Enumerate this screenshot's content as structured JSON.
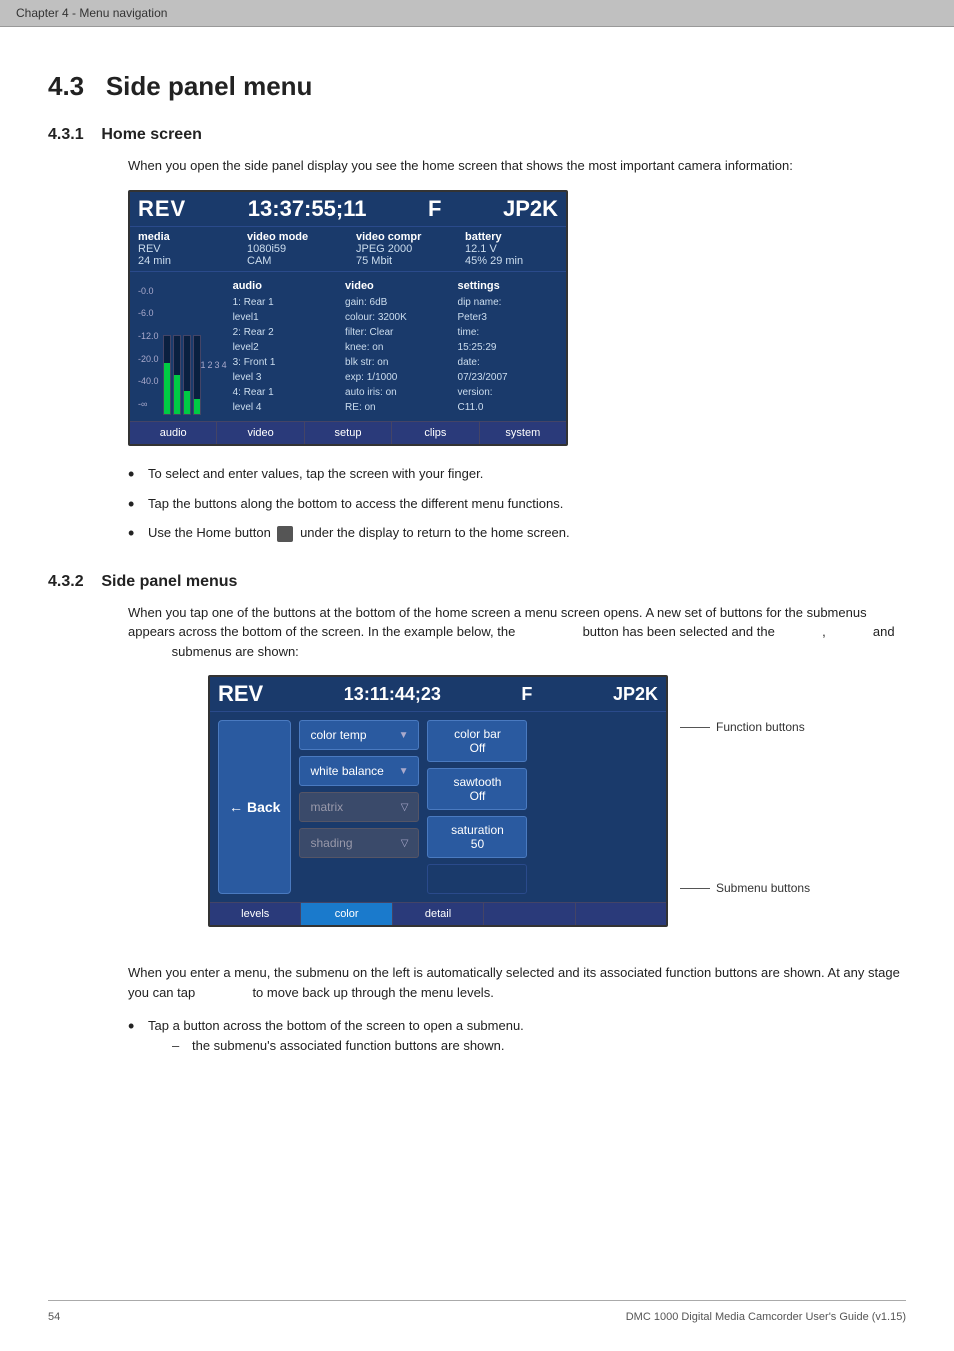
{
  "chapter_header": "Chapter 4  - Menu navigation",
  "section": {
    "number": "4.3",
    "title": "Side panel menu"
  },
  "subsection_1": {
    "number": "4.3.1",
    "title": "Home screen",
    "intro": "When you open the side panel display you see the home screen that shows the most important camera information:"
  },
  "camera_screen_1": {
    "rev": "REV",
    "time": "13:37:55;11",
    "f": "F",
    "jp2k": "JP2K",
    "media_label": "media",
    "media_value": "REV\n24 min",
    "videomode_label": "video mode",
    "videomode_value": "1080i59\nCAM",
    "videocompr_label": "video compr",
    "videocompr_value": "JPEG 2000\n75 Mbit",
    "battery_label": "battery",
    "battery_value": "12.1 V\n45% 29 min",
    "vu_labels": [
      "-0.0",
      "-6.0",
      "-12.0",
      "-20.0",
      "-40.0",
      "-∞"
    ],
    "audio_label": "audio",
    "audio_values": [
      "1: Rear 1",
      "level1",
      "2: Rear 2",
      "level2",
      "3: Front 1",
      "level 3",
      "4: Rear 1",
      "level 4"
    ],
    "video_label": "video",
    "video_values": [
      "gain: 6dB",
      "colour: 3200K",
      "filter: Clear",
      "knee: on",
      "blk str: on",
      "exp: 1/1000",
      "auto iris: on",
      "RE: on"
    ],
    "settings_label": "settings",
    "settings_values": [
      "dip name:",
      "Peter3",
      "time:",
      "15:25:29",
      "date:",
      "07/23/2007",
      "version:",
      "C11.0"
    ],
    "buttons": [
      "audio",
      "video",
      "setup",
      "clips",
      "system"
    ]
  },
  "bullets_1": [
    "To select and enter values, tap the screen with your finger.",
    "Tap the buttons along the bottom to access the different menu functions.",
    "Use the Home button  under the display to return to the home screen."
  ],
  "subsection_2": {
    "number": "4.3.2",
    "title": "Side panel menus",
    "intro": "When you tap one of the buttons at the bottom of the home screen a menu screen opens. A new set of buttons for the submenus appears across the bottom of the screen. In the example below, the        button has been selected and the        ,        and        submenus are shown:"
  },
  "camera_screen_2": {
    "rev": "REV",
    "time": "13:11:44;23",
    "f": "F",
    "jp2k": "JP2K",
    "back_label": "Back",
    "submenu_items": [
      {
        "label": "color temp",
        "arrow": "▼",
        "active": true
      },
      {
        "label": "white balance",
        "arrow": "▼",
        "active": true
      },
      {
        "label": "matrix",
        "arrow": "▽",
        "active": false
      },
      {
        "label": "shading",
        "arrow": "▽",
        "active": false
      }
    ],
    "function_items": [
      {
        "label": "color bar\nOff",
        "active": true
      },
      {
        "label": "sawtooth\nOff",
        "active": true
      },
      {
        "label": "saturation\n50",
        "active": true
      },
      {
        "label": "",
        "active": false
      }
    ],
    "footer_buttons": [
      "levels",
      "color",
      "detail",
      "",
      ""
    ],
    "function_buttons_label": "Function buttons",
    "submenu_buttons_label": "Submenu buttons"
  },
  "section2_para": "When you enter a menu, the submenu on the left is automatically selected and its associated function buttons are shown. At any stage you can tap       to move back up through the menu levels.",
  "bullets_2": [
    {
      "main": "Tap a button across the bottom of the screen to open a submenu.",
      "sub": [
        "the submenu's associated function buttons are shown."
      ]
    }
  ],
  "footer": {
    "page_number": "54",
    "product": "DMC 1000 Digital Media Camcorder User's Guide (v1.15)"
  }
}
